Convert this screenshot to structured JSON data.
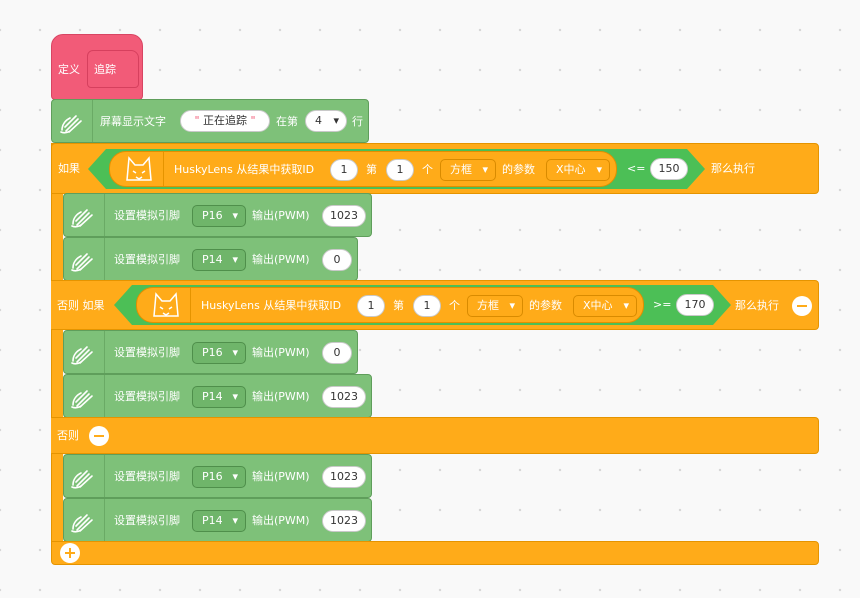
{
  "define_block": {
    "label": "定义",
    "name": "追踪"
  },
  "screen_block": {
    "label": "屏幕显示文字",
    "text_value": "正在追踪",
    "quote_open": "\"",
    "quote_close": "\"",
    "at_label": "在第",
    "row_value": "4",
    "row_suffix": "行"
  },
  "if_block": {
    "if_label": "如果",
    "elseif_label": "否则 如果",
    "else_label": "否则",
    "then_label": "那么执行"
  },
  "conditions": [
    {
      "prefix": "HuskyLens 从结果中获取ID",
      "id_value": "1",
      "di": "第",
      "index_value": "1",
      "ge": "个",
      "shape": "方框",
      "param_label": "的参数",
      "param": "X中心",
      "op": "<=",
      "threshold": "150"
    },
    {
      "prefix": "HuskyLens 从结果中获取ID",
      "id_value": "1",
      "di": "第",
      "index_value": "1",
      "ge": "个",
      "shape": "方框",
      "param_label": "的参数",
      "param": "X中心",
      "op": ">=",
      "threshold": "170"
    }
  ],
  "pwm_blocks": [
    {
      "label": "设置模拟引脚",
      "pin": "P16",
      "out_label": "输出(PWM)",
      "value": "1023"
    },
    {
      "label": "设置模拟引脚",
      "pin": "P14",
      "out_label": "输出(PWM)",
      "value": "0"
    },
    {
      "label": "设置模拟引脚",
      "pin": "P16",
      "out_label": "输出(PWM)",
      "value": "0"
    },
    {
      "label": "设置模拟引脚",
      "pin": "P14",
      "out_label": "输出(PWM)",
      "value": "1023"
    },
    {
      "label": "设置模拟引脚",
      "pin": "P16",
      "out_label": "输出(PWM)",
      "value": "1023"
    },
    {
      "label": "设置模拟引脚",
      "pin": "P14",
      "out_label": "输出(PWM)",
      "value": "1023"
    }
  ],
  "colors": {
    "define": "#f25b78",
    "control": "#ffab19",
    "action": "#7ec179",
    "operator": "#4cbf56"
  }
}
